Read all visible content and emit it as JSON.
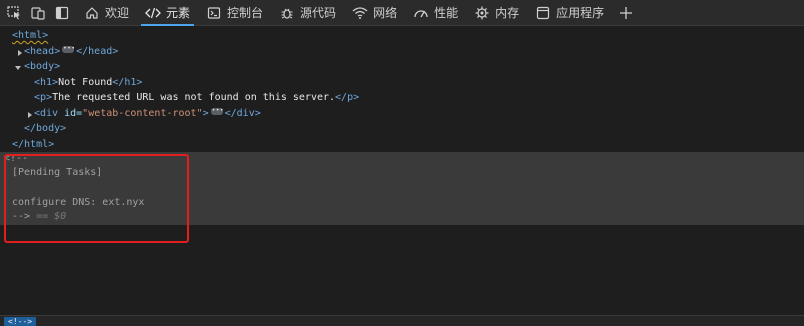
{
  "toolbar": {
    "tabs": [
      {
        "label": "欢迎",
        "icon": "home-icon"
      },
      {
        "label": "元素",
        "icon": "code-brackets-icon",
        "active": true
      },
      {
        "label": "控制台",
        "icon": "console-icon"
      },
      {
        "label": "源代码",
        "icon": "bug-icon"
      },
      {
        "label": "网络",
        "icon": "wifi-icon"
      },
      {
        "label": "性能",
        "icon": "gauge-icon"
      },
      {
        "label": "内存",
        "icon": "chip-icon"
      },
      {
        "label": "应用程序",
        "icon": "window-icon"
      }
    ],
    "add_tab_label": "+"
  },
  "tree": {
    "html_open": "<html>",
    "head_open": "<head>",
    "head_close": "</head>",
    "body_open": "<body>",
    "h1_open": "<h1>",
    "h1_text": "Not Found",
    "h1_close": "</h1>",
    "p_open": "<p>",
    "p_text": "The requested URL was not found on this server.",
    "p_close": "</p>",
    "div_tag_open": "<div ",
    "div_attr_name": "id=",
    "div_attr_val": "\"wetab-content-root\"",
    "div_tag_end": ">",
    "div_close": "</div>",
    "body_close": "</body>",
    "html_close": "</html>"
  },
  "comment": {
    "open": "<!--",
    "line1": "[Pending Tasks]",
    "line2": "configure DNS: ext.nyx",
    "close": "-->",
    "selected_marker": " == $0"
  },
  "breadcrumb": {
    "item": "<!-->"
  },
  "colors": {
    "tag": "#6fa8dc",
    "attr_name": "#9cdcfe",
    "attr_value": "#ce9178",
    "highlight_box": "#e21f1f",
    "active_tab_underline": "#4fa3e8"
  }
}
